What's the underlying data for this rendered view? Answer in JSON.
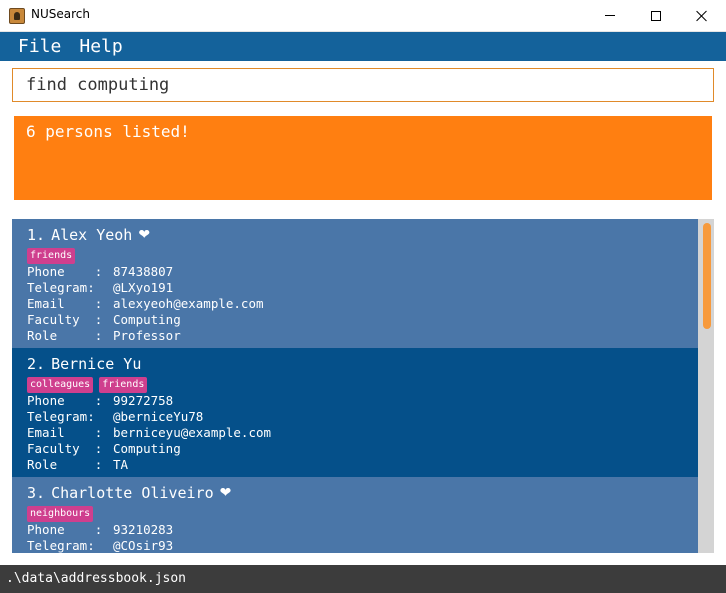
{
  "window": {
    "title": "NUSearch"
  },
  "menu": {
    "file": "File",
    "help": "Help"
  },
  "command": {
    "value": "find computing"
  },
  "result": {
    "text": "6 persons listed!"
  },
  "persons": [
    {
      "index": "1.",
      "name": "Alex Yeoh",
      "favourite": true,
      "tags": [
        "friends"
      ],
      "fields": [
        {
          "label": "Phone    :",
          "value": "87438807"
        },
        {
          "label": "Telegram:",
          "value": "@LXyo191"
        },
        {
          "label": "Email    :",
          "value": "alexyeoh@example.com"
        },
        {
          "label": "Faculty  :",
          "value": "Computing"
        },
        {
          "label": "Role     :",
          "value": "Professor"
        }
      ]
    },
    {
      "index": "2.",
      "name": "Bernice Yu",
      "favourite": false,
      "tags": [
        "colleagues",
        "friends"
      ],
      "fields": [
        {
          "label": "Phone    :",
          "value": "99272758"
        },
        {
          "label": "Telegram:",
          "value": "@berniceYu78"
        },
        {
          "label": "Email    :",
          "value": "berniceyu@example.com"
        },
        {
          "label": "Faculty  :",
          "value": "Computing"
        },
        {
          "label": "Role     :",
          "value": "TA"
        }
      ]
    },
    {
      "index": "3.",
      "name": "Charlotte Oliveiro",
      "favourite": true,
      "tags": [
        "neighbours"
      ],
      "fields": [
        {
          "label": "Phone    :",
          "value": "93210283"
        },
        {
          "label": "Telegram:",
          "value": "@COsir93"
        }
      ]
    }
  ],
  "status": {
    "path": ".\\data\\addressbook.json"
  },
  "colors": {
    "menu_bg": "#14629b",
    "result_bg": "#ff7f11",
    "card_light": "#4a76a8",
    "card_dark": "#05508a",
    "tag_bg": "#cf3f8e",
    "scroll_thumb": "#f79a3c"
  }
}
